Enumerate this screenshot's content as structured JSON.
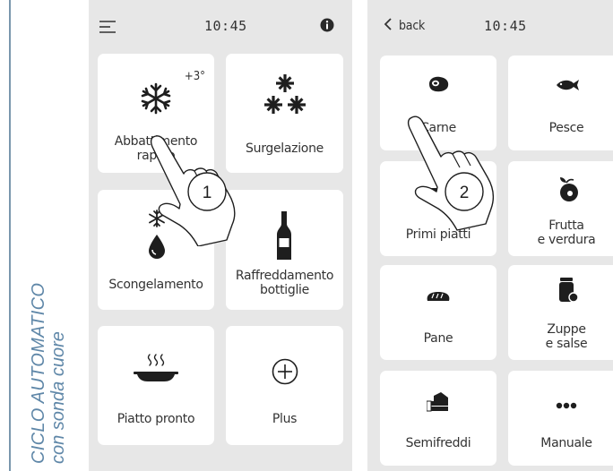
{
  "caption": {
    "line1": "CICLO AUTOMATICO",
    "line2": "con sonda cuore",
    "color": "#5f87a8"
  },
  "left_screen": {
    "time": "10:45",
    "menu_icon": "hamburger-menu-icon",
    "info_icon": "info-icon",
    "tiles": [
      {
        "label_lines": [
          "Abbattimento",
          "rapido"
        ],
        "badge": "+3°",
        "icon": "snowflake-icon"
      },
      {
        "label_lines": [
          "Surgelazione"
        ],
        "icon": "triple-snowflake-icon"
      },
      {
        "label_lines": [
          "Scongelamento"
        ],
        "icon": "snowflake-drop-icon"
      },
      {
        "label_lines": [
          "Raffreddamento",
          "bottiglie"
        ],
        "icon": "bottle-icon"
      },
      {
        "label_lines": [
          "Piatto pronto"
        ],
        "icon": "hot-dish-icon"
      },
      {
        "label_lines": [
          "Plus"
        ],
        "icon": "plus-circle-icon"
      }
    ],
    "gesture_step": "1"
  },
  "right_screen": {
    "back_label": "back",
    "time": "10:45",
    "tiles": [
      {
        "label_lines": [
          "Carne"
        ],
        "icon": "steak-icon"
      },
      {
        "label_lines": [
          "Pesce"
        ],
        "icon": "fish-icon"
      },
      {
        "label_lines": [
          "Primi piatti"
        ],
        "icon": "pasta-icon"
      },
      {
        "label_lines": [
          "Frutta",
          "e verdura"
        ],
        "icon": "fruit-icon"
      },
      {
        "label_lines": [
          "Pane"
        ],
        "icon": "bread-icon"
      },
      {
        "label_lines": [
          "Zuppe",
          "e salse"
        ],
        "icon": "jar-icon"
      },
      {
        "label_lines": [
          "Semifreddi"
        ],
        "icon": "cake-icon"
      },
      {
        "label_lines": [
          "Manuale"
        ],
        "icon": "more-dots-icon"
      }
    ],
    "gesture_step": "2"
  },
  "colors": {
    "screen_bg": "#e7e7e7",
    "tile_bg": "#ffffff",
    "icon": "#1e1e1e",
    "accent_line": "#7a97ad"
  }
}
